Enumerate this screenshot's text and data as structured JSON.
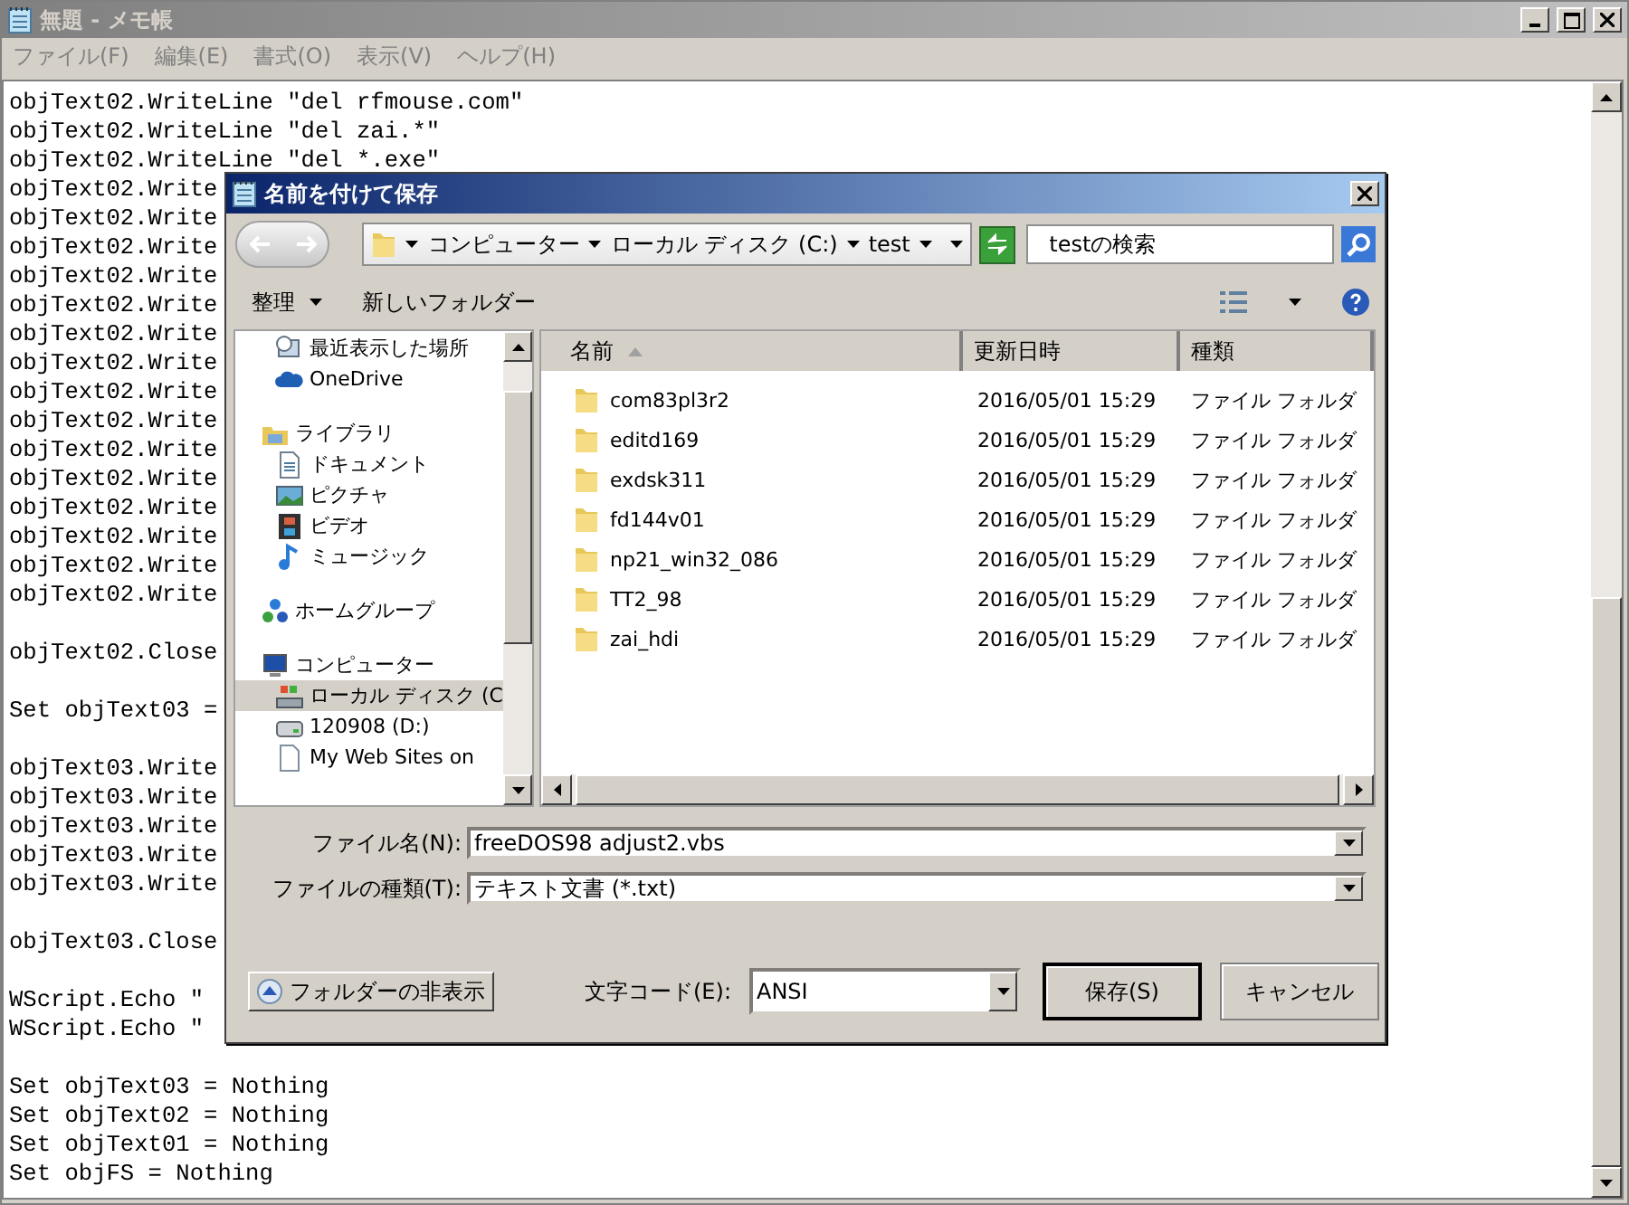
{
  "notepad": {
    "title": "無題 - メモ帳",
    "menu": [
      "ファイル(F)",
      "編集(E)",
      "書式(O)",
      "表示(V)",
      "ヘルプ(H)"
    ],
    "blocks": [
      [
        "objText02.WriteLine \"del rfmouse.com\"",
        "objText02.WriteLine \"del zai.*\"",
        "objText02.WriteLine \"del *.exe\"",
        "objText02.Write",
        "objText02.Write",
        "objText02.Write",
        "objText02.Write",
        "objText02.Write",
        "objText02.Write",
        "objText02.Write",
        "objText02.Write",
        "objText02.Write",
        "objText02.Write",
        "objText02.Write",
        "objText02.Write",
        "objText02.Write",
        "objText02.Write",
        "objText02.Write"
      ],
      [
        "objText02.Close"
      ],
      [
        "Set objText03 ="
      ],
      [
        "objText03.Write",
        "objText03.Write",
        "objText03.Write",
        "objText03.Write",
        "objText03.Write"
      ],
      [
        "objText03.Close"
      ],
      [
        "WScript.Echo \"",
        "WScript.Echo \""
      ],
      [
        "Set objText03 = Nothing",
        "Set objText02 = Nothing",
        "Set objText01 = Nothing",
        "Set objFS = Nothing"
      ]
    ]
  },
  "dialog": {
    "title": "名前を付けて保存",
    "breadcrumb": [
      "コンピューター",
      "ローカル ディスク (C:)",
      "test"
    ],
    "search": {
      "placeholder": "testの検索"
    },
    "toolbar": {
      "organize": "整理",
      "new_folder": "新しいフォルダー"
    },
    "nav": [
      {
        "children": [
          {
            "label": "最近表示した場所",
            "kind": "recent",
            "selected": false
          },
          {
            "label": "OneDrive",
            "kind": "cloud",
            "selected": false
          }
        ]
      },
      {
        "label": "ライブラリ",
        "kind": "library",
        "selected": false,
        "children": [
          {
            "label": "ドキュメント",
            "kind": "document",
            "selected": false
          },
          {
            "label": "ピクチャ",
            "kind": "picture",
            "selected": false
          },
          {
            "label": "ビデオ",
            "kind": "video",
            "selected": false
          },
          {
            "label": "ミュージック",
            "kind": "music",
            "selected": false
          }
        ]
      },
      {
        "label": "ホームグループ",
        "kind": "homegroup",
        "selected": false
      },
      {
        "label": "コンピューター",
        "kind": "computer",
        "selected": false,
        "children": [
          {
            "label": "ローカル ディスク (C",
            "kind": "drive",
            "selected": true
          },
          {
            "label": "120908 (D:)",
            "kind": "removable",
            "selected": false
          },
          {
            "label": "My Web Sites on",
            "kind": "web",
            "selected": false
          }
        ]
      }
    ],
    "columns": [
      "名前",
      "更新日時",
      "種類"
    ],
    "rows": [
      {
        "name": "com83pl3r2",
        "modified": "2016/05/01 15:29",
        "type": "ファイル フォルダ"
      },
      {
        "name": "editd169",
        "modified": "2016/05/01 15:29",
        "type": "ファイル フォルダ"
      },
      {
        "name": "exdsk311",
        "modified": "2016/05/01 15:29",
        "type": "ファイル フォルダ"
      },
      {
        "name": "fd144v01",
        "modified": "2016/05/01 15:29",
        "type": "ファイル フォルダ"
      },
      {
        "name": "np21_win32_086",
        "modified": "2016/05/01 15:29",
        "type": "ファイル フォルダ"
      },
      {
        "name": "TT2_98",
        "modified": "2016/05/01 15:29",
        "type": "ファイル フォルダ"
      },
      {
        "name": "zai_hdi",
        "modified": "2016/05/01 15:29",
        "type": "ファイル フォルダ"
      }
    ],
    "file_name": {
      "label": "ファイル名(N):",
      "value": "freeDOS98 adjust2.vbs"
    },
    "file_type": {
      "label": "ファイルの種類(T):",
      "value": "テキスト文書 (*.txt)"
    },
    "hide_folders": "フォルダーの非表示",
    "encoding": {
      "label": "文字コード(E):",
      "value": "ANSI"
    },
    "buttons": [
      "保存(S)",
      "キャンセル"
    ]
  }
}
